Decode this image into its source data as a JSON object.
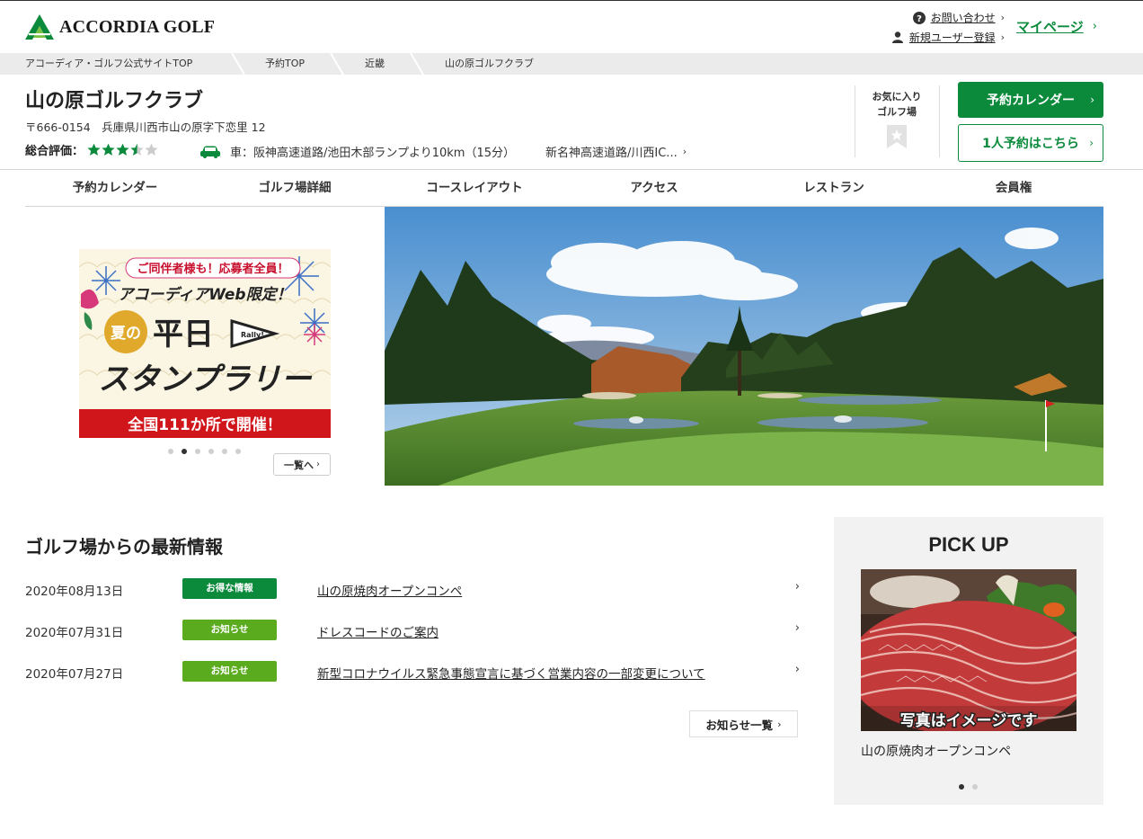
{
  "header": {
    "logo_text": "ACCORDIA GOLF",
    "contact_label": "お問い合わせ",
    "register_label": "新規ユーザー登録",
    "mypage_label": "マイページ",
    "chevron": "›"
  },
  "breadcrumb": [
    "アコーディア・ゴルフ公式サイトTOP",
    "予約TOP",
    "近畿",
    "山の原ゴルフクラブ"
  ],
  "club": {
    "name": "山の原ゴルフクラブ",
    "address": "〒666-0154　兵庫県川西市山の原字下恋里 12",
    "rating_label": "総合評価：",
    "rating": 3.5,
    "rating_max": 5,
    "access_route1": "車：阪神高速道路/池田木部ランプより10km（15分）",
    "access_route2": "新名神高速道路/川西IC..."
  },
  "favorite": {
    "line1": "お気に入り",
    "line2": "ゴルフ場"
  },
  "buttons": {
    "calendar": "予約カレンダー",
    "solo": "1人予約はこちら"
  },
  "tabs": [
    "予約カレンダー",
    "ゴルフ場詳細",
    "コースレイアウト",
    "アクセス",
    "レストラン",
    "会員権"
  ],
  "promo": {
    "banner_top": "ご同伴者様も！応募者全員！",
    "banner_sub": "アコーディアWeb限定！",
    "banner_summer": "夏の",
    "banner_main1": "平日",
    "banner_main2": "スタンプラリー",
    "banner_rally": "Rally!",
    "banner_bottom": "全国111か所で開催！",
    "slide_count": 6,
    "active_slide": 2,
    "list_button": "一覧へ"
  },
  "news": {
    "title": "ゴルフ場からの最新情報",
    "items": [
      {
        "date": "2020年08月13日",
        "badge": "お得な情報",
        "title": "山の原焼肉オープンコンペ"
      },
      {
        "date": "2020年07月31日",
        "badge": "お知らせ",
        "title": "ドレスコードのご案内"
      },
      {
        "date": "2020年07月27日",
        "badge": "お知らせ",
        "title": "新型コロナウイルス緊急事態宣言に基づく営業内容の一部変更について"
      }
    ],
    "all_link": "お知らせ一覧"
  },
  "pickup": {
    "title": "PICK UP",
    "image_overlay": "写真はイメージです",
    "caption": "山の原焼肉オープンコンペ",
    "slide_count": 2,
    "active_slide": 1
  },
  "colors": {
    "brand_green": "#0a8a3a",
    "badge_deal": "#0a8a3a",
    "badge_notice": "#5aab1e",
    "star": "#0a8a3a",
    "star_empty": "#cccccc"
  }
}
